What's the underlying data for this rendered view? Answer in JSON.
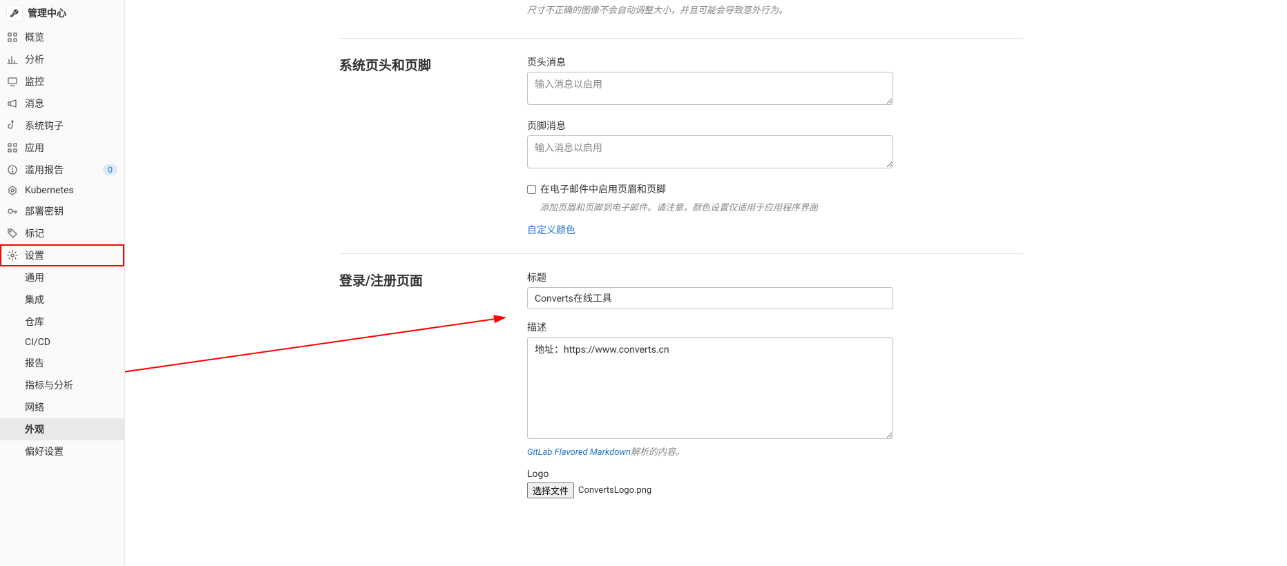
{
  "sidebar": {
    "header": "管理中心",
    "items": [
      {
        "icon": "overview",
        "label": "概览"
      },
      {
        "icon": "chart",
        "label": "分析"
      },
      {
        "icon": "monitor",
        "label": "监控"
      },
      {
        "icon": "megaphone",
        "label": "消息"
      },
      {
        "icon": "hook",
        "label": "系统钩子"
      },
      {
        "icon": "apps",
        "label": "应用"
      },
      {
        "icon": "abuse",
        "label": "滥用报告",
        "badge": "0"
      },
      {
        "icon": "kubernetes",
        "label": "Kubernetes"
      },
      {
        "icon": "key",
        "label": "部署密钥"
      },
      {
        "icon": "tag",
        "label": "标记"
      },
      {
        "icon": "gear",
        "label": "设置",
        "highlighted": true
      }
    ],
    "subitems": [
      {
        "label": "通用"
      },
      {
        "label": "集成"
      },
      {
        "label": "仓库"
      },
      {
        "label": "CI/CD"
      },
      {
        "label": "报告"
      },
      {
        "label": "指标与分析"
      },
      {
        "label": "网络"
      },
      {
        "label": "外观",
        "active": true
      },
      {
        "label": "偏好设置"
      }
    ]
  },
  "top_hint": "尺寸不正确的图像不会自动调整大小，并且可能会导致意外行为。",
  "header_footer": {
    "section_title": "系统页头和页脚",
    "header_label": "页头消息",
    "header_placeholder": "输入消息以启用",
    "footer_label": "页脚消息",
    "footer_placeholder": "输入消息以启用",
    "checkbox_label": "在电子邮件中启用页眉和页脚",
    "checkbox_hint": "添加页眉和页脚到电子邮件。请注意，颜色设置仅适用于应用程序界面",
    "custom_color_link": "自定义颜色"
  },
  "signin": {
    "section_title": "登录/注册页面",
    "title_label": "标题",
    "title_value": "Converts在线工具",
    "desc_label": "描述",
    "desc_value": "地址：https://www.converts.cn",
    "markdown_link": "GitLab Flavored Markdown",
    "markdown_suffix": "解析的内容。",
    "logo_label": "Logo",
    "file_button": "选择文件",
    "file_name": "ConvertsLogo.png"
  }
}
